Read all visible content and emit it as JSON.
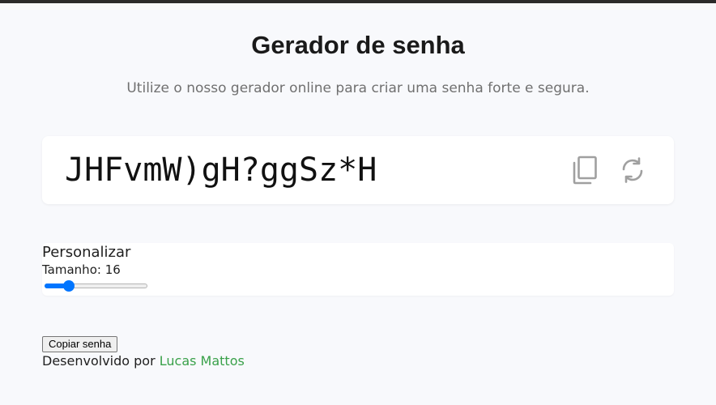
{
  "header": {
    "title": "Gerador de senha",
    "subtitle": "Utilize o nosso gerador online para criar uma senha forte e segura."
  },
  "password": {
    "value": "JHFvmW)gH?ggSz*H",
    "copy_icon": "copy-icon",
    "refresh_icon": "refresh-icon"
  },
  "customize": {
    "title": "Personalizar",
    "size_label": "Tamanho:",
    "size_value": "16",
    "slider": {
      "min": 4,
      "max": 64,
      "value": 16
    }
  },
  "actions": {
    "copy_button_label": "Copiar senha"
  },
  "footer": {
    "prefix": "Desenvolvido por",
    "author": "Lucas Mattos"
  },
  "colors": {
    "accent": "#0075ff",
    "link": "#3aa14a",
    "background": "#f8f9fc",
    "icon": "#a0a0a0"
  }
}
